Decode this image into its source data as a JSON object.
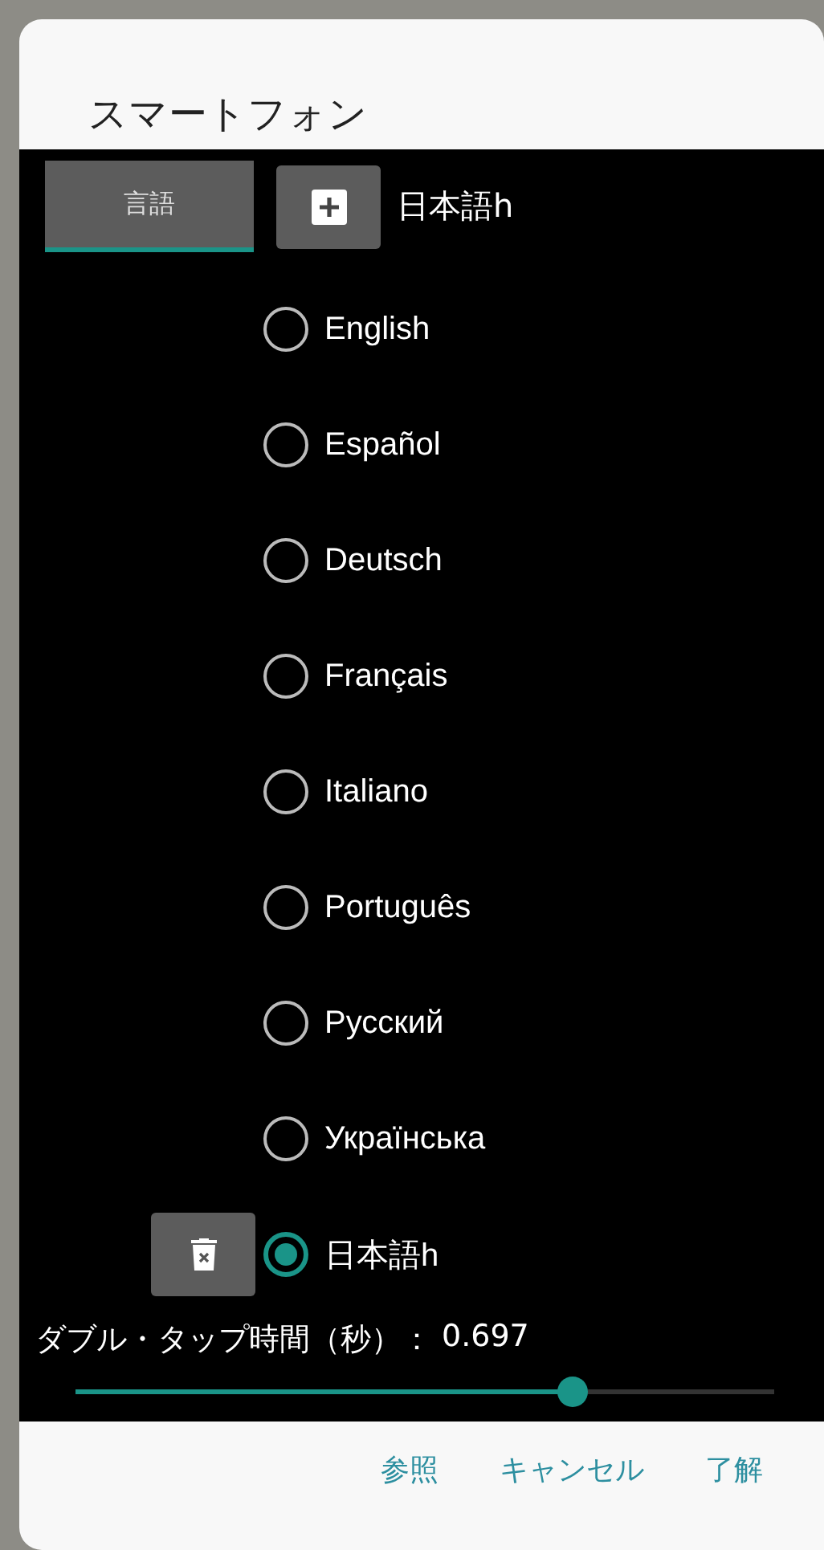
{
  "dialog": {
    "title": "スマートフォン"
  },
  "tab": {
    "label": "言語",
    "selected": true
  },
  "current_language": "日本語h",
  "languages": [
    {
      "label": "English",
      "selected": false,
      "deletable": false
    },
    {
      "label": "Español",
      "selected": false,
      "deletable": false
    },
    {
      "label": "Deutsch",
      "selected": false,
      "deletable": false
    },
    {
      "label": "Français",
      "selected": false,
      "deletable": false
    },
    {
      "label": "Italiano",
      "selected": false,
      "deletable": false
    },
    {
      "label": "Português",
      "selected": false,
      "deletable": false
    },
    {
      "label": "Русский",
      "selected": false,
      "deletable": false
    },
    {
      "label": "Українська",
      "selected": false,
      "deletable": false
    },
    {
      "label": "日本語h",
      "selected": true,
      "deletable": true
    }
  ],
  "double_tap": {
    "label": "ダブル・タップ時間（秒）：",
    "value": "0.697",
    "level": 0.71
  },
  "buttons": [
    "参照",
    "キャンセル",
    "了解"
  ]
}
